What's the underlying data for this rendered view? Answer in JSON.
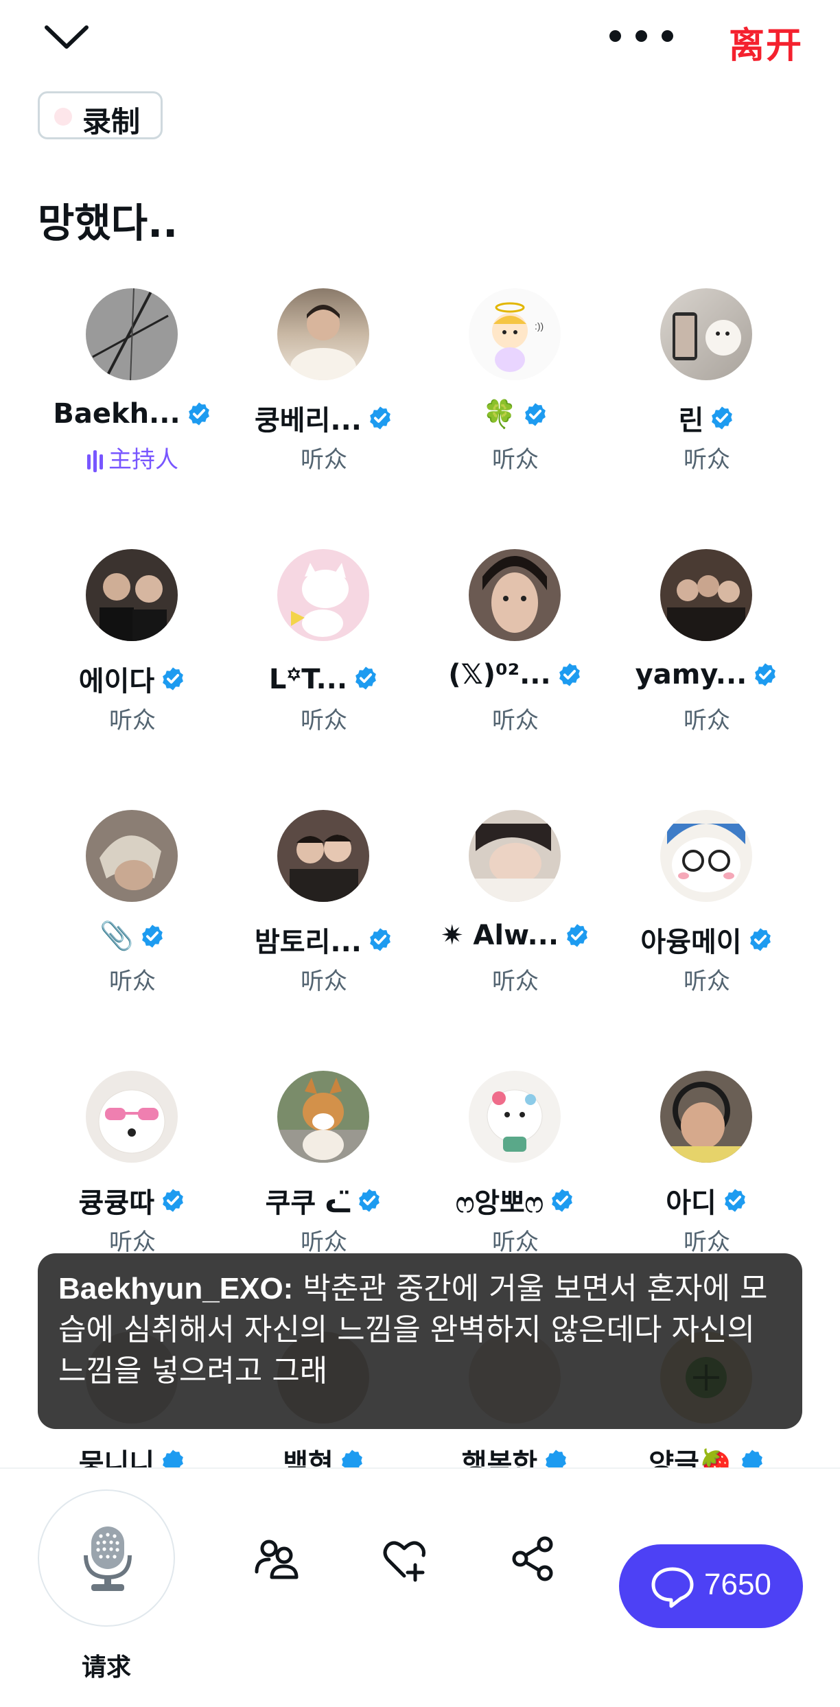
{
  "header": {
    "leave_label": "离开"
  },
  "record": {
    "label": "录制"
  },
  "space_title": "망했다..",
  "participants": [
    {
      "name": "Baekh...",
      "role": "主持人"
    },
    {
      "name": "쿵베리...",
      "role": "听众"
    },
    {
      "name": "🍀",
      "role": "听众"
    },
    {
      "name": "린",
      "role": "听众"
    },
    {
      "name": "에이다",
      "role": "听众"
    },
    {
      "name": "L꙳T...",
      "role": "听众"
    },
    {
      "name": "(𝕏)⁰²...",
      "role": "听众"
    },
    {
      "name": "yamy...",
      "role": "听众"
    },
    {
      "name": "📎",
      "role": "听众"
    },
    {
      "name": "밤토리...",
      "role": "听众"
    },
    {
      "name": "✷ Alw...",
      "role": "听众"
    },
    {
      "name": "아융메이",
      "role": "听众"
    },
    {
      "name": "큥큥따",
      "role": "听众"
    },
    {
      "name": "쿠쿠 ᓚ̈",
      "role": "听众"
    },
    {
      "name": "ෆ앙뽀ෆ",
      "role": "听众"
    },
    {
      "name": "아디",
      "role": "听众"
    }
  ],
  "partial_names": [
    "뭉니니",
    "백현",
    "행복한",
    "양글🍓"
  ],
  "caption": {
    "speaker": "Baekhyun_EXO:",
    "text": "박춘관 중간에 거울 보면서 혼자에 모습에 심취해서 자신의 느낌을 완벽하지 않은데다 자신의 느낌을 넣으려고 그래"
  },
  "bottom": {
    "request_label": "请求",
    "chat_count": "7650"
  },
  "colors": {
    "leave": "#f4212e",
    "verified": "#1d9bf0",
    "host": "#7856ff",
    "chat_button": "#4d41f5"
  }
}
